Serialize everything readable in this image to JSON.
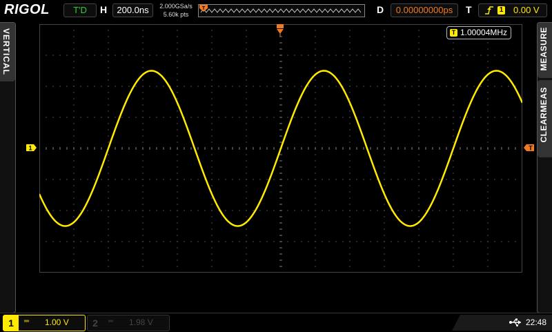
{
  "brand": {
    "logo": "RIGOL"
  },
  "status": {
    "run_state": "T'D",
    "h_label": "H",
    "timebase": "200.0ns",
    "sample_rate": "2.000GSa/s",
    "memory_depth": "5.60k pts",
    "d_label": "D",
    "trigger_delay": "0.00000000ps",
    "t_label": "T",
    "trigger_source": "1",
    "trigger_level": "0.00 V"
  },
  "side_tabs": {
    "left": "VERTICAL",
    "right_top": "MEASURE",
    "right_bottom": "CLEARMEAS"
  },
  "measurement": {
    "badge": "T",
    "frequency": "1.00004MHz"
  },
  "markers": {
    "ch1": "1",
    "trigger": "T"
  },
  "channels": [
    {
      "number": "1",
      "coupling": "═",
      "scale": "1.00 V",
      "active": true
    },
    {
      "number": "2",
      "coupling": "═",
      "scale": "1.98 V",
      "active": false
    }
  ],
  "system": {
    "clock": "22:48",
    "usb_icon": "usb-icon"
  },
  "colors": {
    "ch1": "#ffea00",
    "trigger": "#f07a1f",
    "run": "#2fd02f"
  },
  "waveform": {
    "frequency_hz": 1000040,
    "amplitude_div": 2.5,
    "phase_at_left_div": -1.2
  }
}
